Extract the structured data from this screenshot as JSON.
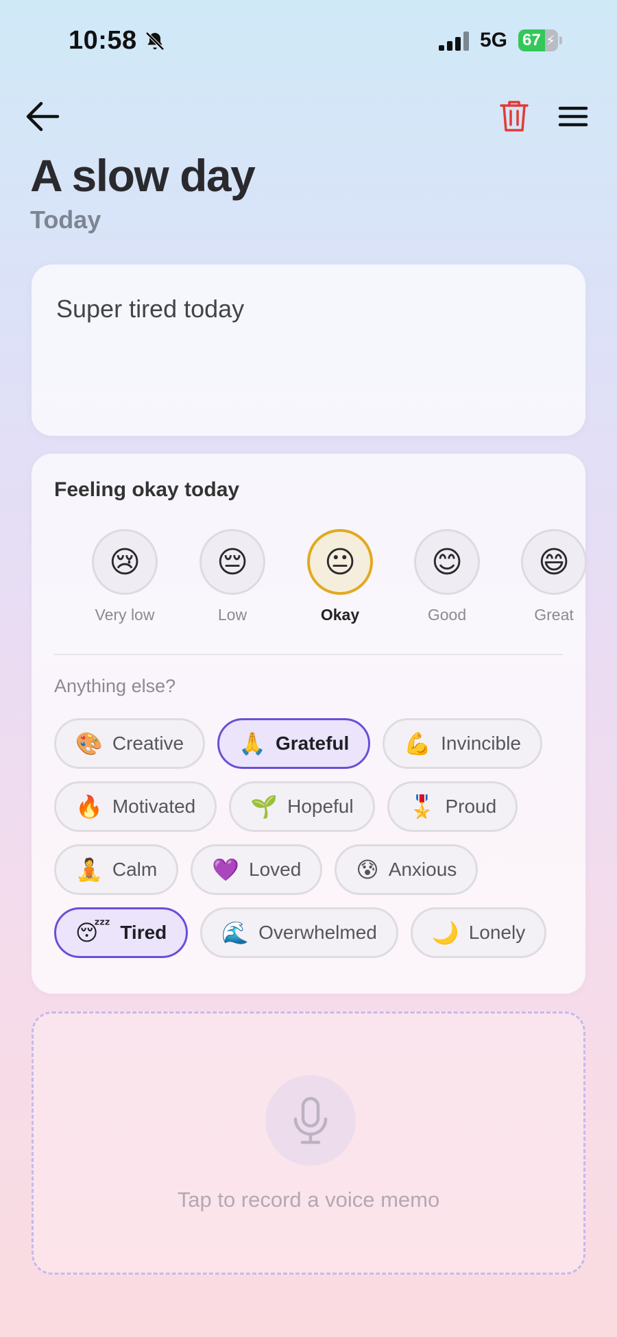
{
  "status_bar": {
    "time": "10:58",
    "network": "5G",
    "battery_percent": "67",
    "battery_color": "#34c759"
  },
  "header": {
    "back_icon": "arrow-left-icon",
    "delete_icon": "trash-icon",
    "delete_color": "#e53935",
    "menu_icon": "hamburger-menu-icon"
  },
  "entry": {
    "title": "A slow day",
    "date": "Today",
    "note": "Super tired today"
  },
  "mood": {
    "heading": "Feeling okay today",
    "selected": "Okay",
    "options": [
      {
        "emoji": "😢",
        "label": "Very low"
      },
      {
        "emoji": "😔",
        "label": "Low"
      },
      {
        "emoji": "😐",
        "label": "Okay"
      },
      {
        "emoji": "😊",
        "label": "Good"
      },
      {
        "emoji": "😄",
        "label": "Great"
      }
    ]
  },
  "feelings": {
    "label": "Anything else?",
    "tags": [
      {
        "emoji": "🎨",
        "label": "Creative",
        "selected": false
      },
      {
        "emoji": "🙏",
        "label": "Grateful",
        "selected": true
      },
      {
        "emoji": "💪",
        "label": "Invincible",
        "selected": false
      },
      {
        "emoji": "🔥",
        "label": "Motivated",
        "selected": false
      },
      {
        "emoji": "🌱",
        "label": "Hopeful",
        "selected": false
      },
      {
        "emoji": "🎖️",
        "label": "Proud",
        "selected": false
      },
      {
        "emoji": "🧘",
        "label": "Calm",
        "selected": false
      },
      {
        "emoji": "💜",
        "label": "Loved",
        "selected": false
      },
      {
        "emoji": "😰",
        "label": "Anxious",
        "selected": false
      },
      {
        "emoji": "😴",
        "label": "Tired",
        "selected": true
      },
      {
        "emoji": "🌊",
        "label": "Overwhelmed",
        "selected": false
      },
      {
        "emoji": "🌙",
        "label": "Lonely",
        "selected": false
      }
    ]
  },
  "voice_memo": {
    "icon": "microphone-icon",
    "prompt": "Tap to record a voice memo"
  }
}
